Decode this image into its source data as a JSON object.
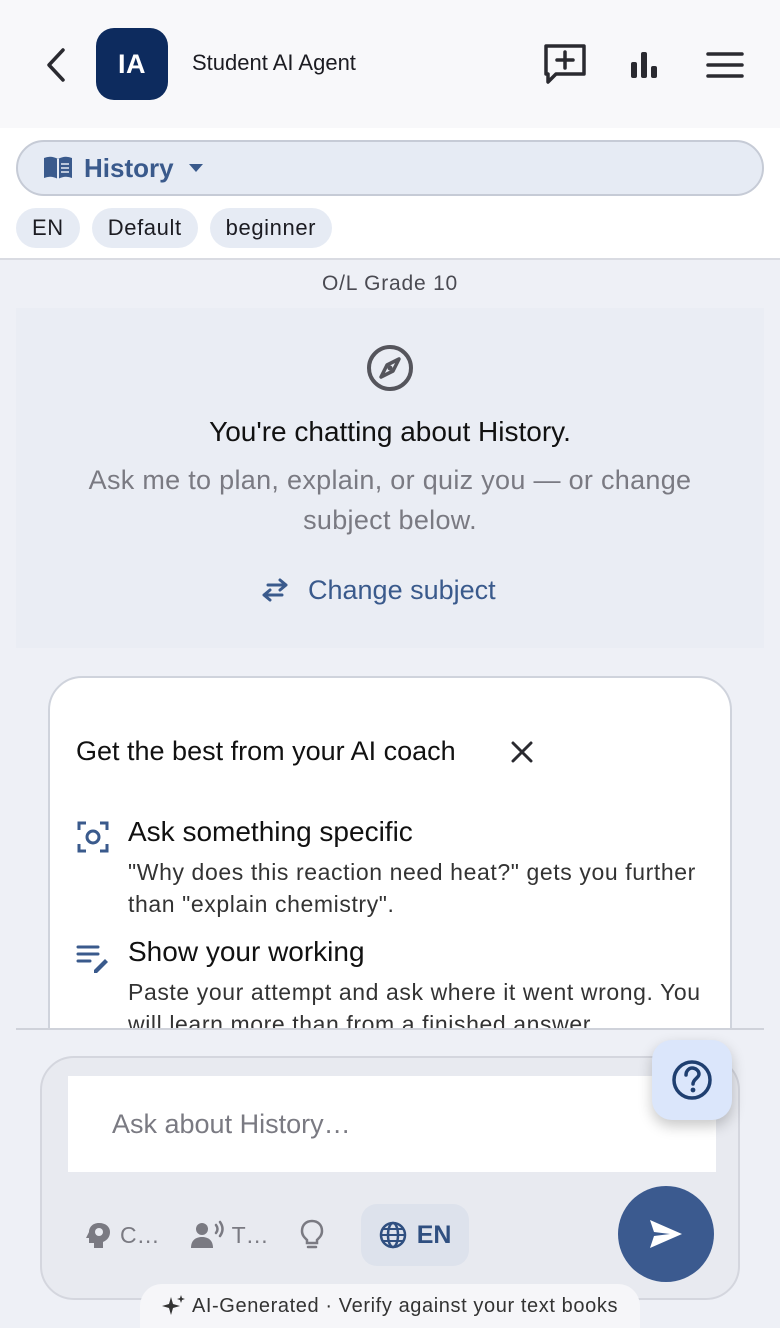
{
  "appbar": {
    "avatar_text": "IA",
    "title": "Student AI Agent",
    "icons": [
      "back-arrow-icon",
      "new-chat-icon",
      "bar-chart-icon",
      "menu-icon"
    ]
  },
  "subject": {
    "label": "History",
    "chips": [
      "EN",
      "Default",
      "beginner"
    ]
  },
  "grade": "O/L Grade 10",
  "welcome": {
    "title": "You're chatting about History.",
    "subtitle": "Ask me to plan, explain, or quiz you — or change subject below.",
    "change_subject_label": "Change subject"
  },
  "tips": {
    "title": "Get the best from your AI coach",
    "items": [
      {
        "icon": "focus-icon",
        "heading": "Ask something specific",
        "body": "\"Why does this reaction need heat?\" gets you further than \"explain chemistry\"."
      },
      {
        "icon": "edit-notes-icon",
        "heading": "Show your working",
        "body": "Paste your attempt and ask where it went wrong. You will learn more than from a finished answer."
      }
    ]
  },
  "composer": {
    "placeholder": "Ask about History…",
    "tools": [
      {
        "icon": "brain-icon",
        "label": "C…"
      },
      {
        "icon": "voice-icon",
        "label": "T…"
      },
      {
        "icon": "lightbulb-icon",
        "label": ""
      }
    ],
    "language": "EN"
  },
  "footer_note": "AI-Generated · Verify against your text books",
  "colors": {
    "brand": "#0d2b5e",
    "accent": "#3b5a8f",
    "background": "#eef0f6"
  }
}
